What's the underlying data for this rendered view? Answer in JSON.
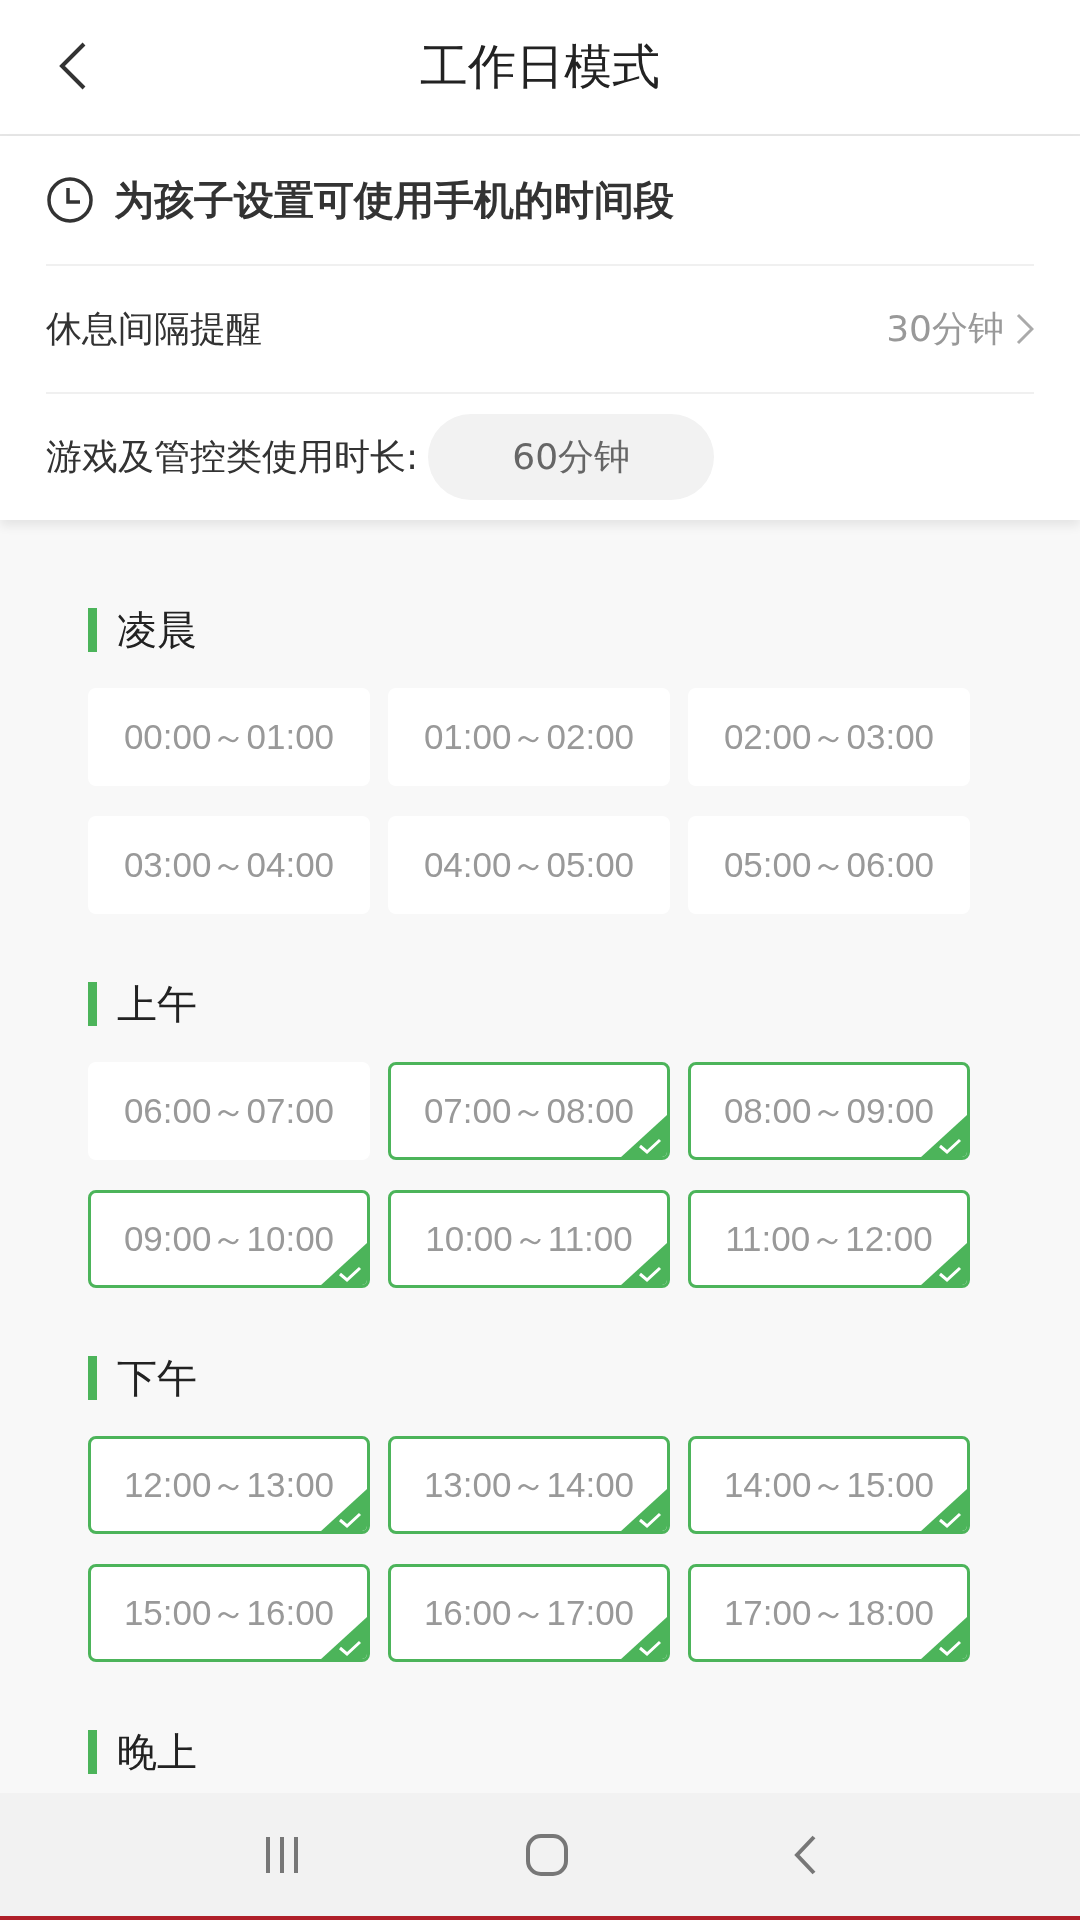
{
  "top_bar": {
    "title": "工作日模式"
  },
  "heading": "为孩子设置可使用手机的时间段",
  "rest_reminder": {
    "label": "休息间隔提醒",
    "value": "30分钟"
  },
  "game_limit": {
    "label": "游戏及管控类使用时长:",
    "value": "60分钟"
  },
  "sections": [
    {
      "title": "凌晨",
      "slots": [
        {
          "label": "00:00～01:00",
          "selected": false
        },
        {
          "label": "01:00～02:00",
          "selected": false
        },
        {
          "label": "02:00～03:00",
          "selected": false
        },
        {
          "label": "03:00～04:00",
          "selected": false
        },
        {
          "label": "04:00～05:00",
          "selected": false
        },
        {
          "label": "05:00～06:00",
          "selected": false
        }
      ]
    },
    {
      "title": "上午",
      "slots": [
        {
          "label": "06:00～07:00",
          "selected": false
        },
        {
          "label": "07:00～08:00",
          "selected": true
        },
        {
          "label": "08:00～09:00",
          "selected": true
        },
        {
          "label": "09:00～10:00",
          "selected": true
        },
        {
          "label": "10:00～11:00",
          "selected": true
        },
        {
          "label": "11:00～12:00",
          "selected": true
        }
      ]
    },
    {
      "title": "下午",
      "slots": [
        {
          "label": "12:00～13:00",
          "selected": true
        },
        {
          "label": "13:00～14:00",
          "selected": true
        },
        {
          "label": "14:00～15:00",
          "selected": true
        },
        {
          "label": "15:00～16:00",
          "selected": true
        },
        {
          "label": "16:00～17:00",
          "selected": true
        },
        {
          "label": "17:00～18:00",
          "selected": true
        }
      ]
    },
    {
      "title": "晚上"
    }
  ]
}
